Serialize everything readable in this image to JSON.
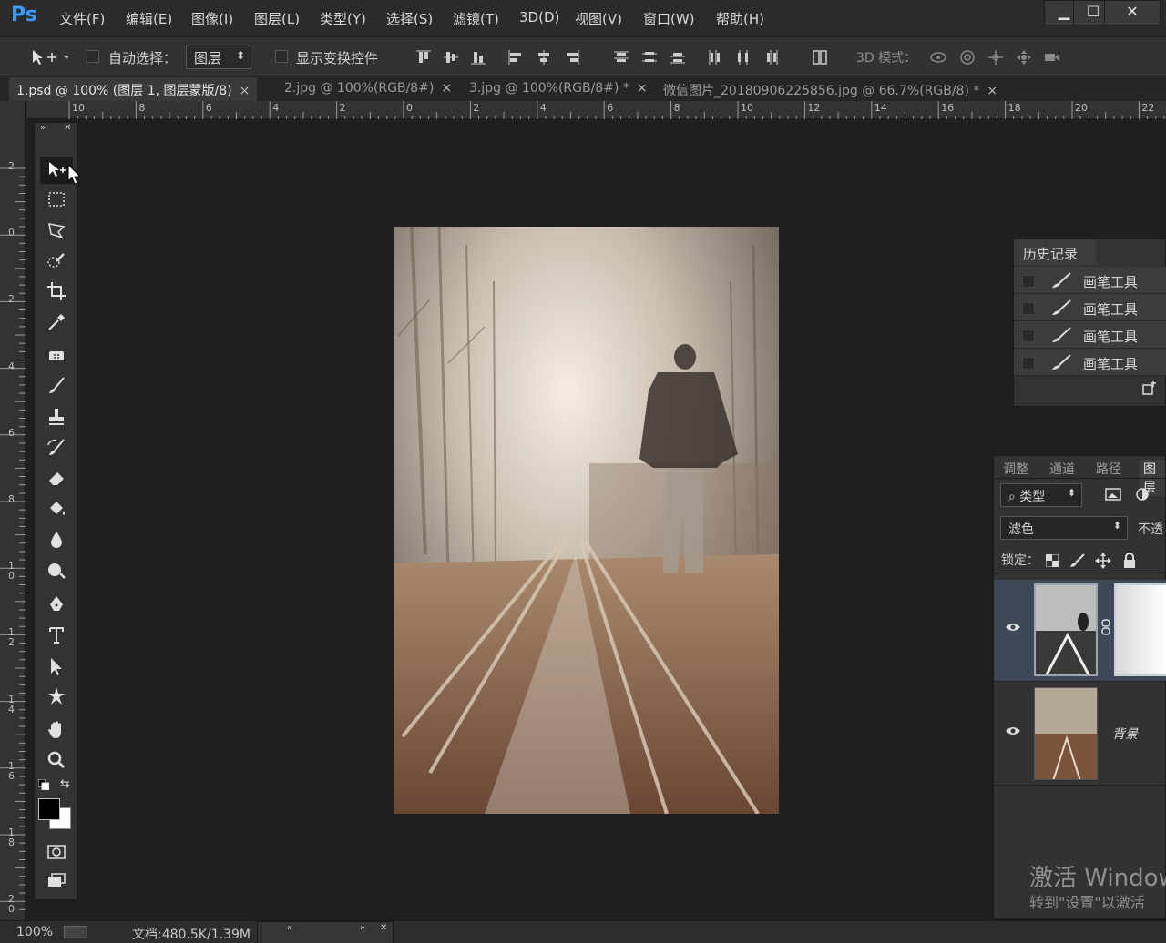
{
  "app": {
    "logo": "Ps",
    "menu": [
      "文件(F)",
      "编辑(E)",
      "图像(I)",
      "图层(L)",
      "类型(Y)",
      "选择(S)",
      "滤镜(T)",
      "3D(D)",
      "视图(V)",
      "窗口(W)",
      "帮助(H)"
    ],
    "window_buttons": [
      "▁",
      "☐",
      "✕"
    ]
  },
  "options": {
    "move_tool_icon": "move-icon",
    "auto_select_label": "自动选择：",
    "auto_select_value": "图层",
    "show_transform_label": "显示变换控件",
    "mode_3d_label": "3D 模式："
  },
  "tabs": [
    {
      "label": "1.psd @ 100% (图层 1, 图层蒙版/8)",
      "active": true
    },
    {
      "label": "2.jpg @ 100%(RGB/8#)",
      "active": false
    },
    {
      "label": "3.jpg @ 100%(RGB/8#) *",
      "active": false
    },
    {
      "label": "微信图片_20180906225856.jpg @ 66.7%(RGB/8) *",
      "active": false
    }
  ],
  "tab_close": "×",
  "ruler": {
    "horizontal": [
      "10",
      "8",
      "6",
      "4",
      "2",
      "0",
      "2",
      "4",
      "6",
      "8",
      "10",
      "12",
      "14",
      "16",
      "18",
      "20",
      "22"
    ],
    "vertical": [
      "2",
      "0",
      "2",
      "4",
      "6",
      "8",
      "10",
      "12",
      "14",
      "16",
      "18",
      "20"
    ]
  },
  "history": {
    "title": "历史记录",
    "items": [
      "画笔工具",
      "画笔工具",
      "画笔工具",
      "画笔工具"
    ]
  },
  "layers": {
    "tabs": [
      "调整",
      "通道",
      "路径",
      "图层"
    ],
    "filter_label": "类型",
    "blend_mode": "滤色",
    "opacity_label": "不透",
    "lock_label": "锁定：",
    "layer_names": [
      "",
      "背景"
    ]
  },
  "watermark": {
    "line1": "激活 Window",
    "line2": "转到\"设置\"以激活"
  },
  "status": {
    "zoom": "100%",
    "doc_info": "文档:480.5K/1.39M"
  }
}
